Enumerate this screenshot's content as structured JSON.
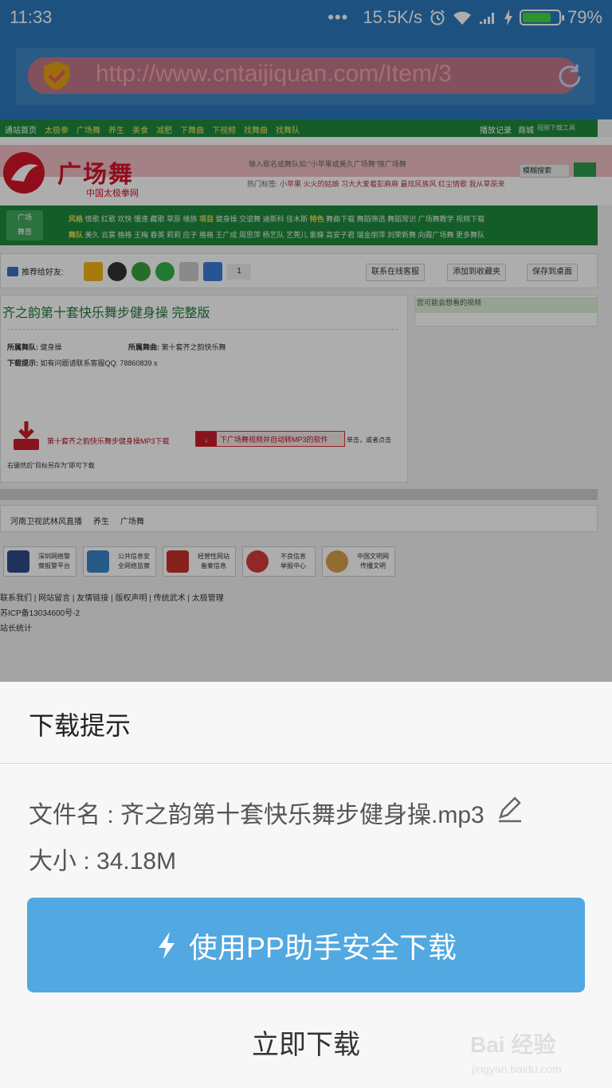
{
  "status_bar": {
    "time": "11:33",
    "dots": "•••",
    "speed": "15.5K/s",
    "battery": "79%",
    "battery_level": 0.79
  },
  "url_bar": {
    "url": "http://www.cntaijiquan.com/Item/3"
  },
  "web": {
    "nav_items": [
      "通站首页",
      "太极拳",
      "广场舞",
      "养生",
      "美食",
      "减肥",
      "下舞曲",
      "下视频",
      "找舞曲",
      "找舞队"
    ],
    "nav_right": [
      "播放记录",
      "商城"
    ],
    "nav_tiny": "视频下载工具",
    "logo_text": "广场舞",
    "logo_sub": "中国太极拳网",
    "search_placeholder": "输入歌名或舞队如:\"小苹果或美久广场舞\"搜广场舞",
    "search_mode": "模糊搜索",
    "hot_label": "热门标签:",
    "hot_words": "小苹果 火火的姑娘 习大大爱着彭麻麻 最炫民族风 红尘情歌 我从草原来",
    "cat_label": [
      "广场",
      "舞首"
    ],
    "cat_row1_head": "风格",
    "cat_row1": "情歌 红歌 欢快 慢速 藏歌 草原 维族",
    "cat_row1_head2": "项目",
    "cat_row1b": "健身操 交谊舞 迪斯科 佳木斯",
    "cat_row1_head3": "特色",
    "cat_row1c": "舞曲下载 舞蹈筛选 舞蹈常识 广场舞教学 视频下载",
    "cat_row2_head": "舞队",
    "cat_row2": "美久 云裳 格格 王梅 春英 莉莉 应子 格格 王广成 周思萍 杨艺队 艺莞儿 紫蝶 高安子君 瑞金丽萍 刘荣新舞 向霞广场舞 更多舞队",
    "share_label": "推荐给好友:",
    "share_count": "1",
    "btn_service": "联系在线客服",
    "btn_fav": "添加到收藏夹",
    "btn_desktop": "保存到桌面",
    "item_title": "齐之韵第十套快乐舞步健身操 完整版",
    "team_label": "所属舞队:",
    "team_value": "健身操",
    "song_label": "所属舞曲:",
    "song_value": "第十套齐之韵快乐舞",
    "tip_label": "下载提示:",
    "tip_value": "如有问题请联系客服QQ: 78860839 s",
    "dl_text": "第十套齐之韵快乐舞步健身操MP3下载",
    "dl_btn": "下广场舞视频并自动转MP3的软件",
    "dl_after": "单击，或者点击",
    "dl_hint": "右键然后\"目标另存为\"即可下载",
    "side_title": "您可能会想看的视频",
    "friend_links": [
      "河南卫视武林风直播",
      "养生",
      "广场舞"
    ],
    "badges": [
      {
        "line1": "深圳网络警",
        "line2": "察报警平台"
      },
      {
        "line1": "公共信息安",
        "line2": "全网络监察"
      },
      {
        "line1": "经营性网站",
        "line2": "备案信息"
      },
      {
        "line1": "不良信息",
        "line2": "举报中心"
      },
      {
        "line1": "中国文明网",
        "line2": "传播文明"
      }
    ],
    "footer1": "联系我们 | 网站留言 | 友情链接 | 版权声明 | 传统武术 | 太极管理",
    "footer2": "苏ICP备13034600号-2",
    "footer3": "站长统计"
  },
  "sheet": {
    "title": "下载提示",
    "filename": "文件名 : 齐之韵第十套快乐舞步健身操.mp3",
    "size": "大小 : 34.18M",
    "pp_button": "使用PP助手安全下载",
    "direct_button": "立即下载",
    "watermark1": "Bai 经验",
    "watermark2": "jingyan.baidu.com"
  },
  "colors": {
    "topbar": "#2b79bd",
    "pp_button": "#52a8e0",
    "site_green": "#1e8a3c"
  },
  "icons": {
    "clock": "alarm-clock-icon",
    "wifi": "wifi-icon",
    "signal": "signal-icon",
    "charging": "charging-bolt-icon",
    "shield": "security-shield-icon",
    "refresh": "refresh-icon",
    "edit": "edit-pencil-icon",
    "bolt": "lightning-bolt-icon"
  }
}
